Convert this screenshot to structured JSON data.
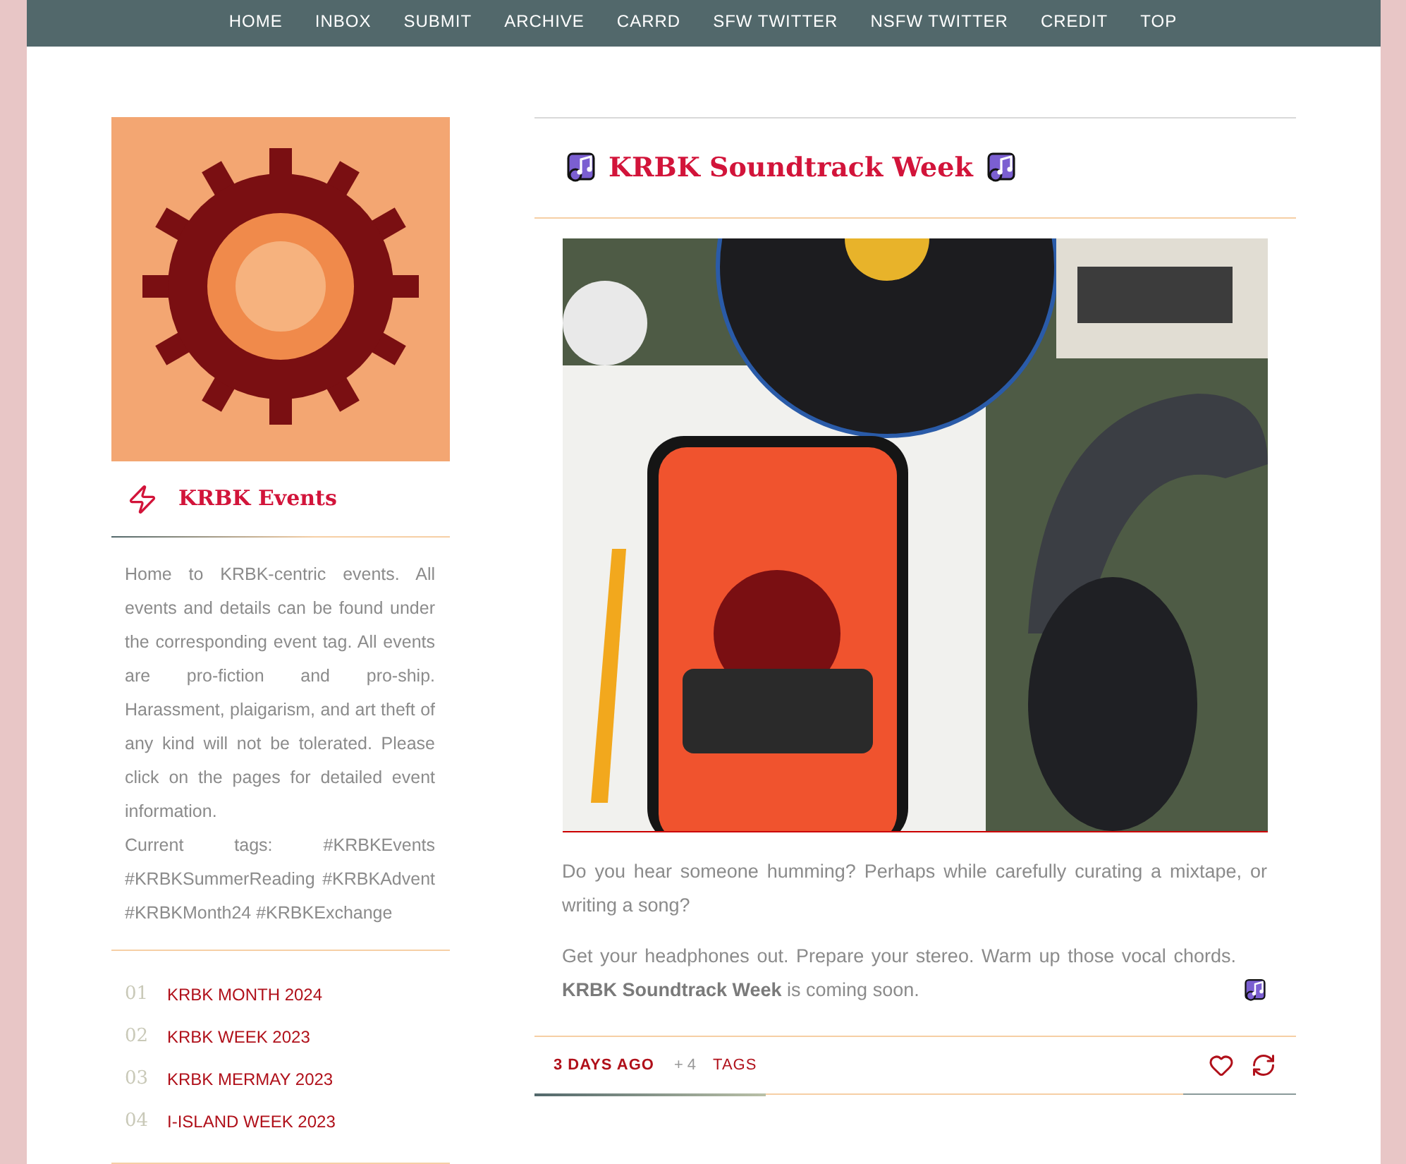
{
  "nav": [
    "HOME",
    "INBOX",
    "SUBMIT",
    "ARCHIVE",
    "CARRD",
    "SFW TWITTER",
    "NSFW TWITTER",
    "CREDIT",
    "TOP"
  ],
  "sidebar": {
    "title": "KRBK Events",
    "description": "Home to KRBK-centric events. All events and details can be found under the corresponding event tag. All events are pro-fiction and pro-ship. Harassment, plaigarism, and art theft of any kind will not be tolerated. Please click on the pages for detailed event information.",
    "tags_line": "Current tags: #KRBKEvents #KRBKSummerReading #KRBKAdvent #KRBKMonth24 #KRBKExchange",
    "events": [
      {
        "number": "01",
        "label": "KRBK MONTH 2024"
      },
      {
        "number": "02",
        "label": "KRBK WEEK 2023"
      },
      {
        "number": "03",
        "label": "KRBK MERMAY 2023"
      },
      {
        "number": "04",
        "label": "I-ISLAND WEEK 2023"
      }
    ]
  },
  "post": {
    "title": "KRBK Soundtrack Week",
    "paragraphs": [
      "Do you hear someone humming? Perhaps while carefully curating a mixtape, or writing a song?",
      "Get your headphones out. Prepare your stereo. Warm up those vocal chords. **KRBK Soundtrack Week** is coming soon."
    ],
    "footer": {
      "time": "3 DAYS AGO",
      "notes": "+ 4",
      "tags": "TAGS"
    }
  }
}
